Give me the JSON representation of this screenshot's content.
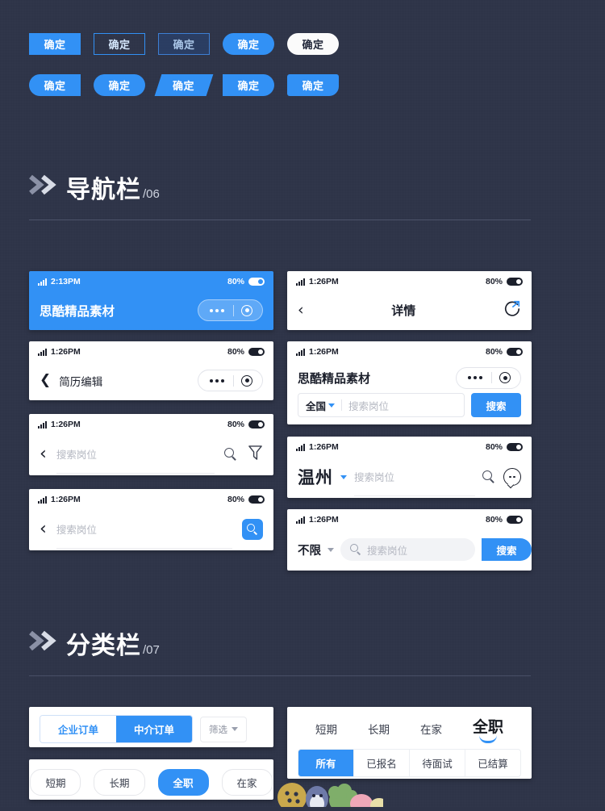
{
  "buttons": {
    "row1": [
      {
        "label": "确定",
        "style": "solid",
        "name": "button-solid-rect"
      },
      {
        "label": "确定",
        "style": "outline",
        "name": "button-outline"
      },
      {
        "label": "确定",
        "style": "outline-fill",
        "name": "button-outline-filled"
      },
      {
        "label": "确定",
        "style": "pill",
        "name": "button-pill-blue"
      },
      {
        "label": "确定",
        "style": "white",
        "name": "button-pill-white"
      }
    ],
    "row2": [
      {
        "label": "确定",
        "style": "round-left",
        "name": "button-round-left"
      },
      {
        "label": "确定",
        "style": "pill",
        "name": "button-pill-blue-2"
      },
      {
        "label": "确定",
        "style": "skew",
        "name": "button-parallelogram"
      },
      {
        "label": "确定",
        "style": "round-right",
        "name": "button-round-right"
      },
      {
        "label": "确定",
        "style": "corner",
        "name": "button-corner-round"
      }
    ]
  },
  "sections": [
    {
      "title": "导航栏",
      "number": "/06"
    },
    {
      "title": "分类栏",
      "number": "/07"
    }
  ],
  "navbars": {
    "blue_title": {
      "time": "2:13PM",
      "battery": "80%",
      "title": "思酷精品素材"
    },
    "detail": {
      "time": "1:26PM",
      "battery": "80%",
      "title": "详情"
    },
    "resume_edit": {
      "time": "1:26PM",
      "battery": "80%",
      "title": "简历编辑"
    },
    "search_national": {
      "time": "1:26PM",
      "battery": "80%",
      "title": "思酷精品素材",
      "region": "全国",
      "placeholder": "搜索岗位",
      "search_button": "搜索"
    },
    "search_filter": {
      "time": "1:26PM",
      "battery": "80%",
      "placeholder": "搜索岗位"
    },
    "search_wenzhou": {
      "time": "1:26PM",
      "battery": "80%",
      "city": "温州",
      "placeholder": "搜索岗位"
    },
    "search_blue_square": {
      "time": "1:26PM",
      "battery": "80%",
      "placeholder": "搜索岗位"
    },
    "search_unlimited": {
      "time": "1:26PM",
      "battery": "80%",
      "region": "不限",
      "placeholder": "搜索岗位",
      "search_button": "搜索"
    }
  },
  "categories": {
    "order_tabs": {
      "items": [
        {
          "label": "企业订单",
          "active": false
        },
        {
          "label": "中介订单",
          "active": true
        }
      ],
      "filter_label": "筛选"
    },
    "job_tabs": {
      "items": [
        {
          "label": "短期",
          "active": false
        },
        {
          "label": "长期",
          "active": false
        },
        {
          "label": "在家",
          "active": false
        },
        {
          "label": "全职",
          "active": true
        }
      ],
      "sub_items": [
        {
          "label": "所有",
          "active": true
        },
        {
          "label": "已报名",
          "active": false
        },
        {
          "label": "待面试",
          "active": false
        },
        {
          "label": "已结算",
          "active": false
        }
      ]
    },
    "chips": [
      {
        "label": "短期",
        "active": false
      },
      {
        "label": "长期",
        "active": false
      },
      {
        "label": "全职",
        "active": true
      },
      {
        "label": "在家",
        "active": false
      }
    ]
  },
  "colors": {
    "background": "#2e3448",
    "accent": "#3291f5",
    "text_dark": "#1b1f2b",
    "placeholder": "#b5b8c2"
  }
}
